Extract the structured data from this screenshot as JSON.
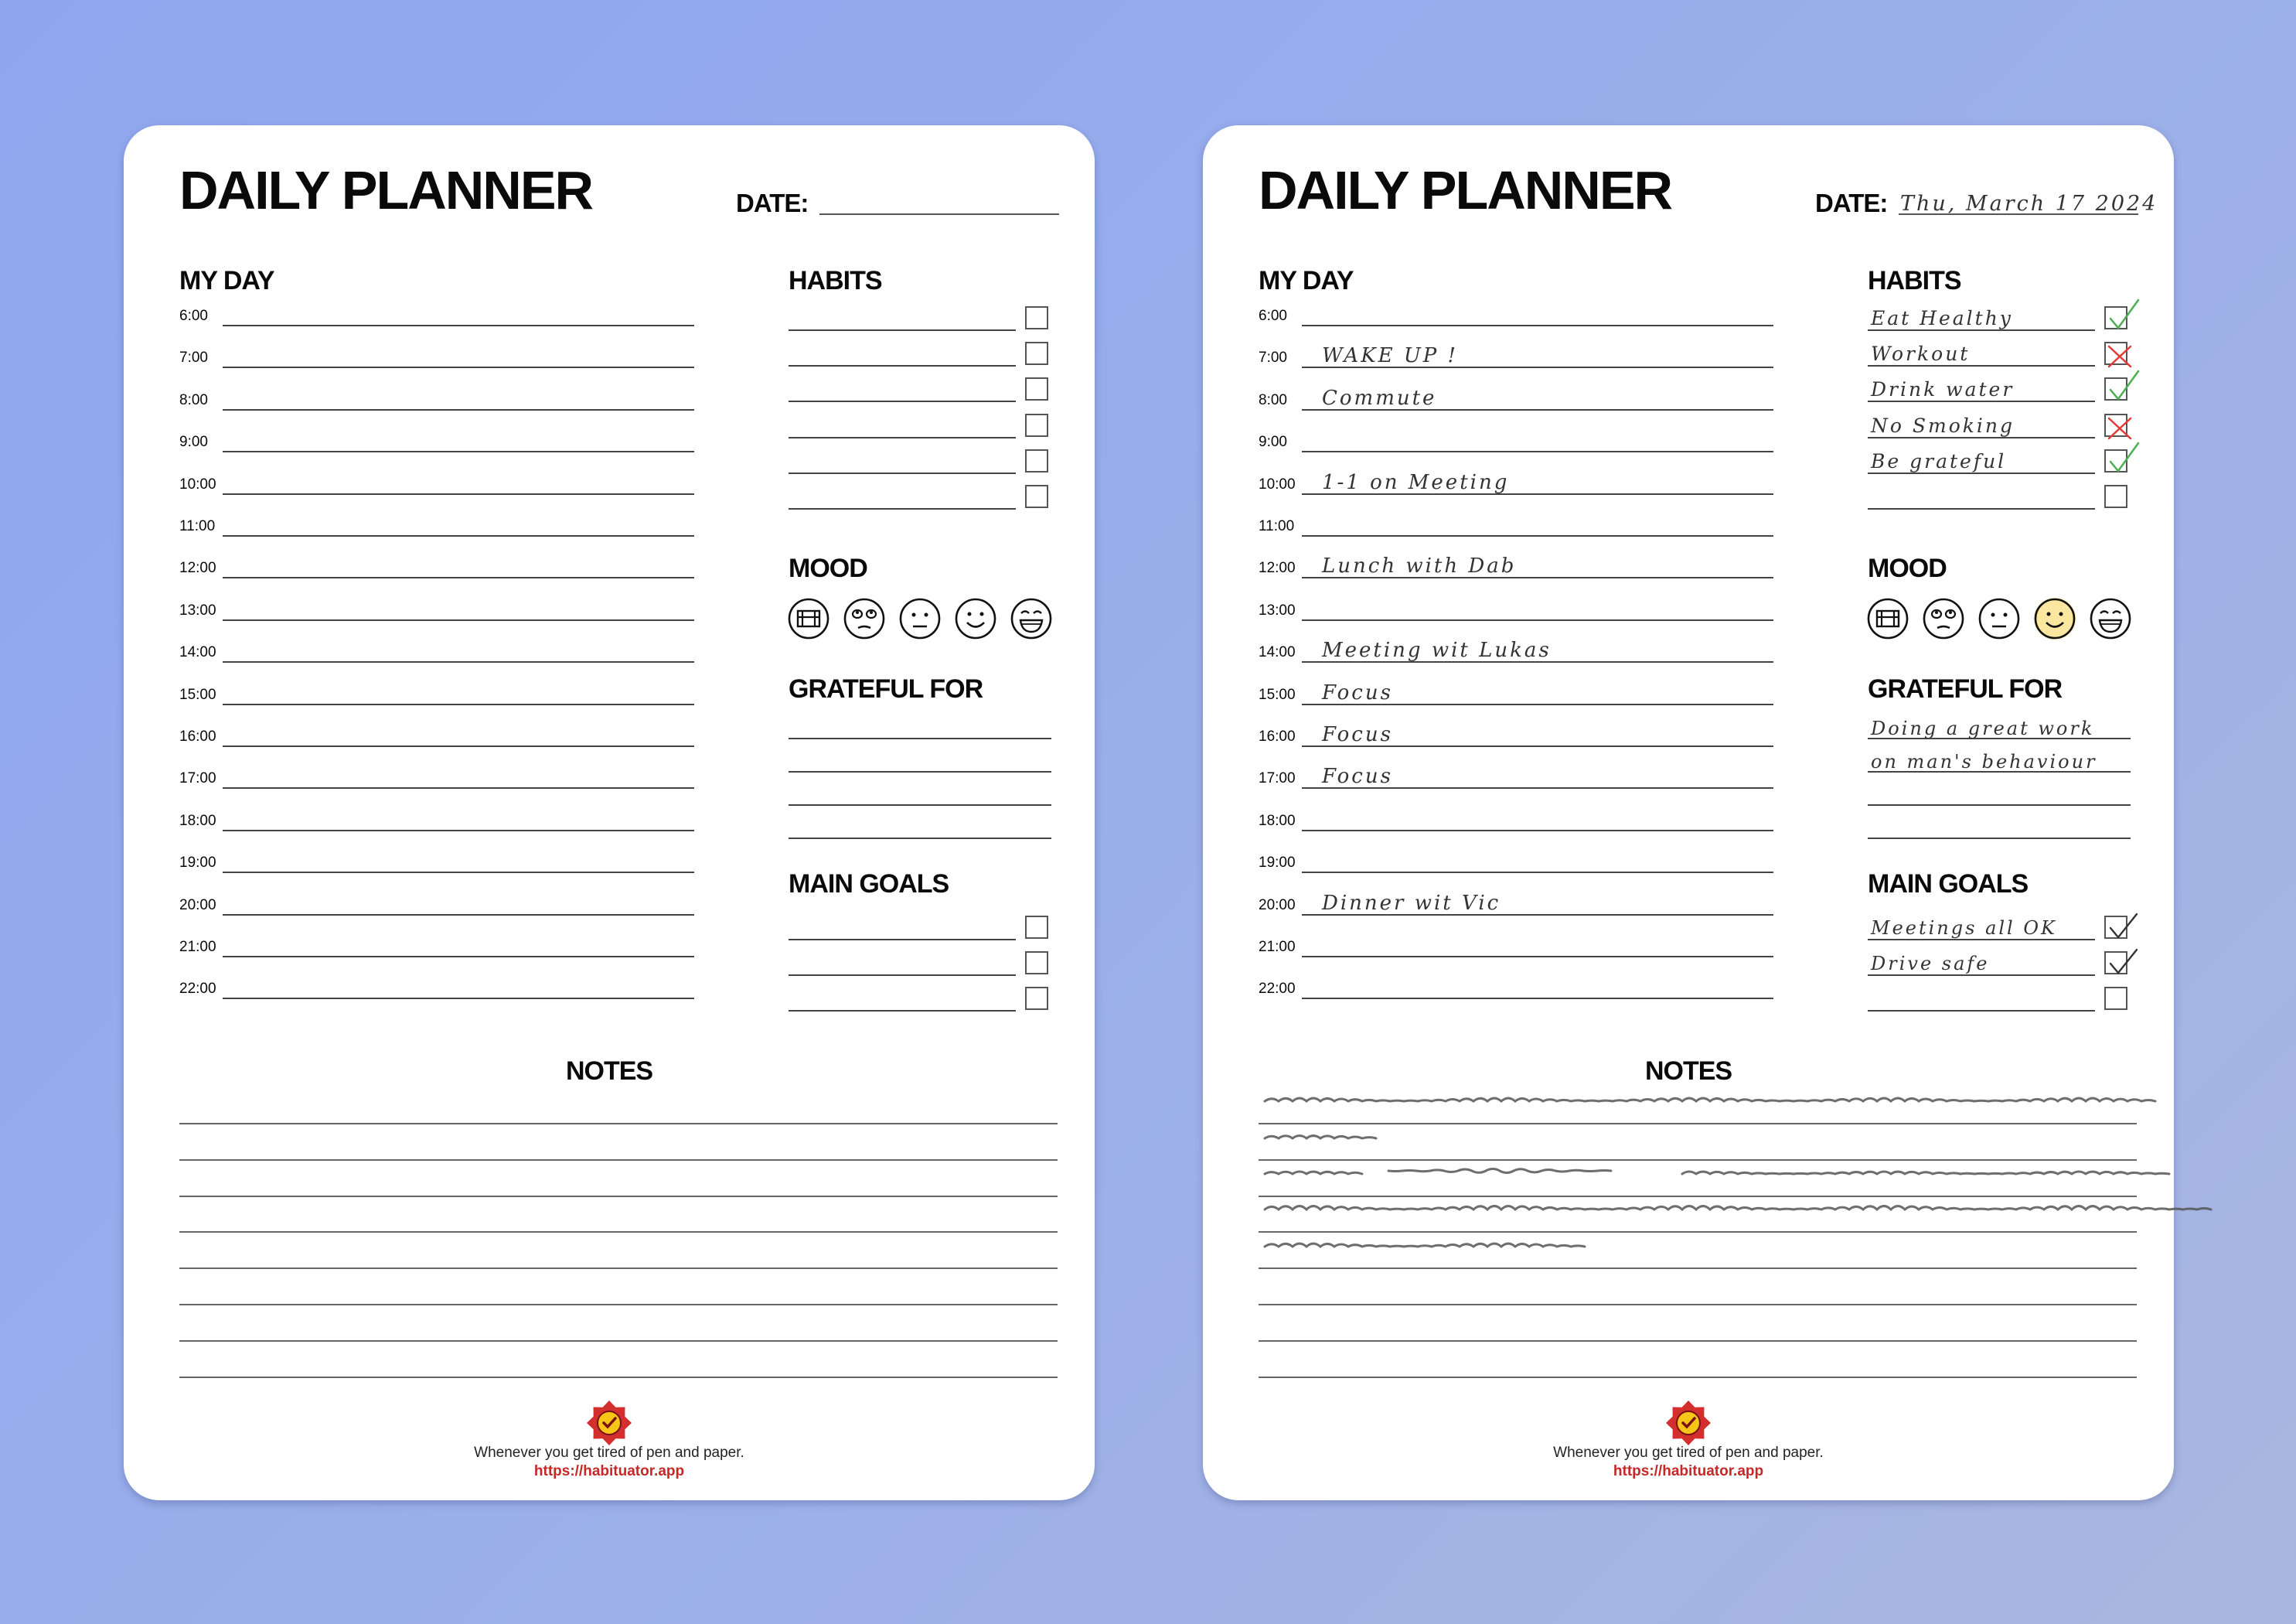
{
  "planner": {
    "title": "DAILY PLANNER",
    "date_label": "DATE:",
    "my_day_title": "MY DAY",
    "habits_title": "HABITS",
    "mood_title": "MOOD",
    "grateful_title": "GRATEFUL FOR",
    "goals_title": "MAIN GOALS",
    "notes_title": "NOTES",
    "hours": [
      "6:00",
      "7:00",
      "8:00",
      "9:00",
      "10:00",
      "11:00",
      "12:00",
      "13:00",
      "14:00",
      "15:00",
      "16:00",
      "17:00",
      "18:00",
      "19:00",
      "20:00",
      "21:00",
      "22:00"
    ],
    "footer_tagline": "Whenever you get tired of pen and paper.",
    "footer_url": "https://habituator.app",
    "brand_color": "#c62828",
    "badge_color": "#d32f2f",
    "check_color": "#f5c518"
  },
  "filled": {
    "date": "Thu, March 17 2024",
    "schedule": [
      {
        "hour": "7:00",
        "text": "WAKE UP !"
      },
      {
        "hour": "8:00",
        "text": "Commute"
      },
      {
        "hour": "10:00",
        "text": "1-1 on Meeting"
      },
      {
        "hour": "12:00",
        "text": "Lunch with Dab"
      },
      {
        "hour": "14:00",
        "text": "Meeting wit Lukas"
      },
      {
        "hour": "15:00",
        "text": "Focus"
      },
      {
        "hour": "16:00",
        "text": "Focus"
      },
      {
        "hour": "17:00",
        "text": "Focus"
      },
      {
        "hour": "20:00",
        "text": "Dinner wit Vic"
      }
    ],
    "habits": [
      {
        "text": "Eat Healthy",
        "status": "done"
      },
      {
        "text": "Workout",
        "status": "missed"
      },
      {
        "text": "Drink water",
        "status": "done"
      },
      {
        "text": "No Smoking",
        "status": "missed"
      },
      {
        "text": "Be grateful",
        "status": "done"
      },
      {
        "text": "",
        "status": "empty"
      }
    ],
    "mood_selected_index": 3,
    "mood_highlight_color": "#f4d35e",
    "done_color": "#4caf50",
    "missed_color": "#e53935",
    "grateful": [
      "Doing a great work",
      "on man's behaviour",
      "",
      ""
    ],
    "goals": [
      {
        "text": "Meetings all OK",
        "status": "checked"
      },
      {
        "text": "Drive safe",
        "status": "checked"
      },
      {
        "text": "",
        "status": "empty"
      }
    ]
  }
}
